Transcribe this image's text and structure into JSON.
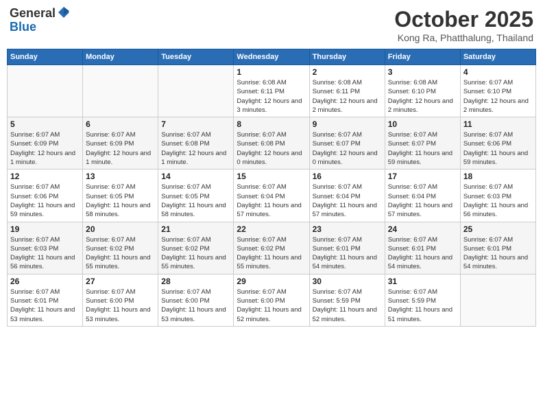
{
  "header": {
    "logo_general": "General",
    "logo_blue": "Blue",
    "month": "October 2025",
    "location": "Kong Ra, Phatthalung, Thailand"
  },
  "weekdays": [
    "Sunday",
    "Monday",
    "Tuesday",
    "Wednesday",
    "Thursday",
    "Friday",
    "Saturday"
  ],
  "weeks": [
    [
      {
        "day": "",
        "detail": ""
      },
      {
        "day": "",
        "detail": ""
      },
      {
        "day": "",
        "detail": ""
      },
      {
        "day": "1",
        "detail": "Sunrise: 6:08 AM\nSunset: 6:11 PM\nDaylight: 12 hours\nand 3 minutes."
      },
      {
        "day": "2",
        "detail": "Sunrise: 6:08 AM\nSunset: 6:11 PM\nDaylight: 12 hours\nand 2 minutes."
      },
      {
        "day": "3",
        "detail": "Sunrise: 6:08 AM\nSunset: 6:10 PM\nDaylight: 12 hours\nand 2 minutes."
      },
      {
        "day": "4",
        "detail": "Sunrise: 6:07 AM\nSunset: 6:10 PM\nDaylight: 12 hours\nand 2 minutes."
      }
    ],
    [
      {
        "day": "5",
        "detail": "Sunrise: 6:07 AM\nSunset: 6:09 PM\nDaylight: 12 hours\nand 1 minute."
      },
      {
        "day": "6",
        "detail": "Sunrise: 6:07 AM\nSunset: 6:09 PM\nDaylight: 12 hours\nand 1 minute."
      },
      {
        "day": "7",
        "detail": "Sunrise: 6:07 AM\nSunset: 6:08 PM\nDaylight: 12 hours\nand 1 minute."
      },
      {
        "day": "8",
        "detail": "Sunrise: 6:07 AM\nSunset: 6:08 PM\nDaylight: 12 hours\nand 0 minutes."
      },
      {
        "day": "9",
        "detail": "Sunrise: 6:07 AM\nSunset: 6:07 PM\nDaylight: 12 hours\nand 0 minutes."
      },
      {
        "day": "10",
        "detail": "Sunrise: 6:07 AM\nSunset: 6:07 PM\nDaylight: 11 hours\nand 59 minutes."
      },
      {
        "day": "11",
        "detail": "Sunrise: 6:07 AM\nSunset: 6:06 PM\nDaylight: 11 hours\nand 59 minutes."
      }
    ],
    [
      {
        "day": "12",
        "detail": "Sunrise: 6:07 AM\nSunset: 6:06 PM\nDaylight: 11 hours\nand 59 minutes."
      },
      {
        "day": "13",
        "detail": "Sunrise: 6:07 AM\nSunset: 6:05 PM\nDaylight: 11 hours\nand 58 minutes."
      },
      {
        "day": "14",
        "detail": "Sunrise: 6:07 AM\nSunset: 6:05 PM\nDaylight: 11 hours\nand 58 minutes."
      },
      {
        "day": "15",
        "detail": "Sunrise: 6:07 AM\nSunset: 6:04 PM\nDaylight: 11 hours\nand 57 minutes."
      },
      {
        "day": "16",
        "detail": "Sunrise: 6:07 AM\nSunset: 6:04 PM\nDaylight: 11 hours\nand 57 minutes."
      },
      {
        "day": "17",
        "detail": "Sunrise: 6:07 AM\nSunset: 6:04 PM\nDaylight: 11 hours\nand 57 minutes."
      },
      {
        "day": "18",
        "detail": "Sunrise: 6:07 AM\nSunset: 6:03 PM\nDaylight: 11 hours\nand 56 minutes."
      }
    ],
    [
      {
        "day": "19",
        "detail": "Sunrise: 6:07 AM\nSunset: 6:03 PM\nDaylight: 11 hours\nand 56 minutes."
      },
      {
        "day": "20",
        "detail": "Sunrise: 6:07 AM\nSunset: 6:02 PM\nDaylight: 11 hours\nand 55 minutes."
      },
      {
        "day": "21",
        "detail": "Sunrise: 6:07 AM\nSunset: 6:02 PM\nDaylight: 11 hours\nand 55 minutes."
      },
      {
        "day": "22",
        "detail": "Sunrise: 6:07 AM\nSunset: 6:02 PM\nDaylight: 11 hours\nand 55 minutes."
      },
      {
        "day": "23",
        "detail": "Sunrise: 6:07 AM\nSunset: 6:01 PM\nDaylight: 11 hours\nand 54 minutes."
      },
      {
        "day": "24",
        "detail": "Sunrise: 6:07 AM\nSunset: 6:01 PM\nDaylight: 11 hours\nand 54 minutes."
      },
      {
        "day": "25",
        "detail": "Sunrise: 6:07 AM\nSunset: 6:01 PM\nDaylight: 11 hours\nand 54 minutes."
      }
    ],
    [
      {
        "day": "26",
        "detail": "Sunrise: 6:07 AM\nSunset: 6:01 PM\nDaylight: 11 hours\nand 53 minutes."
      },
      {
        "day": "27",
        "detail": "Sunrise: 6:07 AM\nSunset: 6:00 PM\nDaylight: 11 hours\nand 53 minutes."
      },
      {
        "day": "28",
        "detail": "Sunrise: 6:07 AM\nSunset: 6:00 PM\nDaylight: 11 hours\nand 53 minutes."
      },
      {
        "day": "29",
        "detail": "Sunrise: 6:07 AM\nSunset: 6:00 PM\nDaylight: 11 hours\nand 52 minutes."
      },
      {
        "day": "30",
        "detail": "Sunrise: 6:07 AM\nSunset: 5:59 PM\nDaylight: 11 hours\nand 52 minutes."
      },
      {
        "day": "31",
        "detail": "Sunrise: 6:07 AM\nSunset: 5:59 PM\nDaylight: 11 hours\nand 51 minutes."
      },
      {
        "day": "",
        "detail": ""
      }
    ]
  ]
}
